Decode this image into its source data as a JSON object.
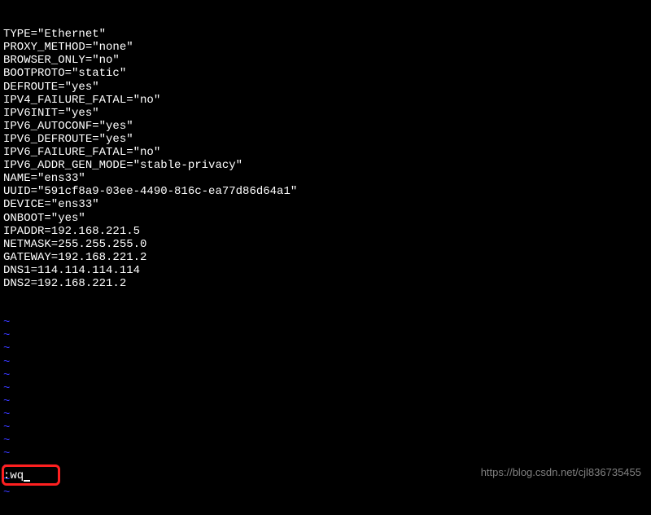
{
  "config": {
    "lines": [
      "TYPE=\"Ethernet\"",
      "PROXY_METHOD=\"none\"",
      "BROWSER_ONLY=\"no\"",
      "BOOTPROTO=\"static\"",
      "DEFROUTE=\"yes\"",
      "IPV4_FAILURE_FATAL=\"no\"",
      "IPV6INIT=\"yes\"",
      "IPV6_AUTOCONF=\"yes\"",
      "IPV6_DEFROUTE=\"yes\"",
      "IPV6_FAILURE_FATAL=\"no\"",
      "IPV6_ADDR_GEN_MODE=\"stable-privacy\"",
      "NAME=\"ens33\"",
      "UUID=\"591cf8a9-03ee-4490-816c-ea77d86d64a1\"",
      "DEVICE=\"ens33\"",
      "ONBOOT=\"yes\"",
      "IPADDR=192.168.221.5",
      "NETMASK=255.255.255.0",
      "GATEWAY=192.168.221.2",
      "DNS1=114.114.114.114",
      "DNS2=192.168.221.2"
    ]
  },
  "tilde": "~",
  "tilde_count": 14,
  "command": {
    "prefix": ":",
    "text": "wq"
  },
  "watermark": "https://blog.csdn.net/cjl836735455"
}
